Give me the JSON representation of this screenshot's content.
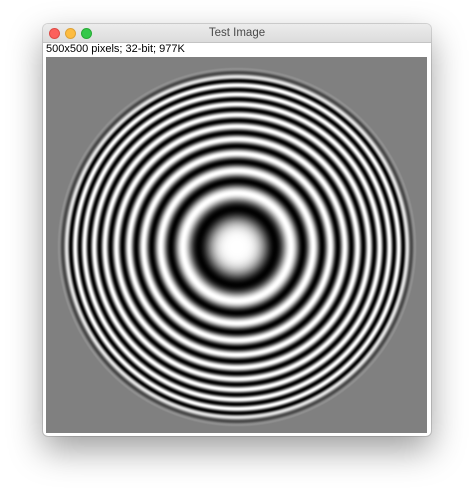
{
  "window": {
    "title": "Test Image",
    "info": "500x500 pixels; 32-bit; 977K",
    "controls": {
      "close_color": "#fc605c",
      "minimize_color": "#fdbc40",
      "zoom_color": "#34c84a"
    }
  },
  "image": {
    "pattern": "concentric-rings",
    "background_color": "#808080",
    "foreground_colors": [
      "#000000",
      "#ffffff"
    ]
  }
}
